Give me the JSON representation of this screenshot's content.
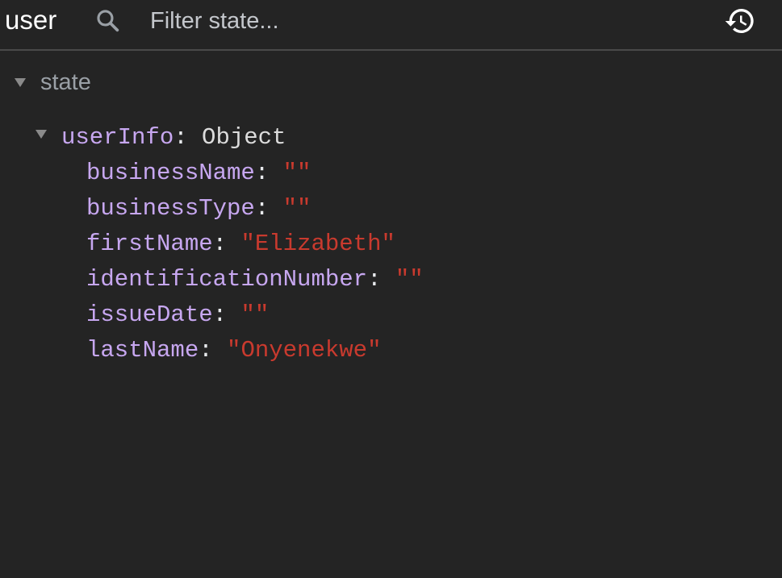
{
  "header": {
    "store_name": "user",
    "filter_placeholder": "Filter state...",
    "filter_value": "",
    "search_icon": "search-icon",
    "history_icon": "history-icon"
  },
  "tree": {
    "root_label": "state",
    "object": {
      "key": "userInfo",
      "type": "Object",
      "properties": [
        {
          "key": "businessName",
          "value": "\"\""
        },
        {
          "key": "businessType",
          "value": "\"\""
        },
        {
          "key": "firstName",
          "value": "\"Elizabeth\""
        },
        {
          "key": "identificationNumber",
          "value": "\"\""
        },
        {
          "key": "issueDate",
          "value": "\"\""
        },
        {
          "key": "lastName",
          "value": "\"Onyenekwe\""
        }
      ]
    }
  },
  "colors": {
    "background": "#242424",
    "key": "#c7a7f0",
    "string": "#c93a2e"
  }
}
